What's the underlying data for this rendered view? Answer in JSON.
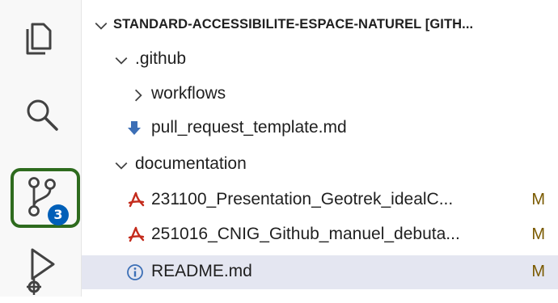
{
  "explorer": {
    "root_label": "STANDARD-ACCESSIBILITE-ESPACE-NATUREL [GITH...",
    "items": [
      {
        "label": ".github"
      },
      {
        "label": "workflows"
      },
      {
        "label": "pull_request_template.md"
      },
      {
        "label": "documentation"
      },
      {
        "label": "231100_Presentation_Geotrek_idealC...",
        "status": "M"
      },
      {
        "label": "251016_CNIG_Github_manuel_debuta...",
        "status": "M"
      },
      {
        "label": "README.md",
        "status": "M"
      }
    ]
  },
  "activity_bar": {
    "source_control_badge": "3",
    "highlight_color": "#2e6b1e",
    "badge_color": "#005fb8"
  },
  "colors": {
    "pdf_icon": "#c42b1c",
    "markdown_icon": "#3c6fb6",
    "modified_status": "#7a5a00",
    "selected_row": "#e4e6f1"
  }
}
